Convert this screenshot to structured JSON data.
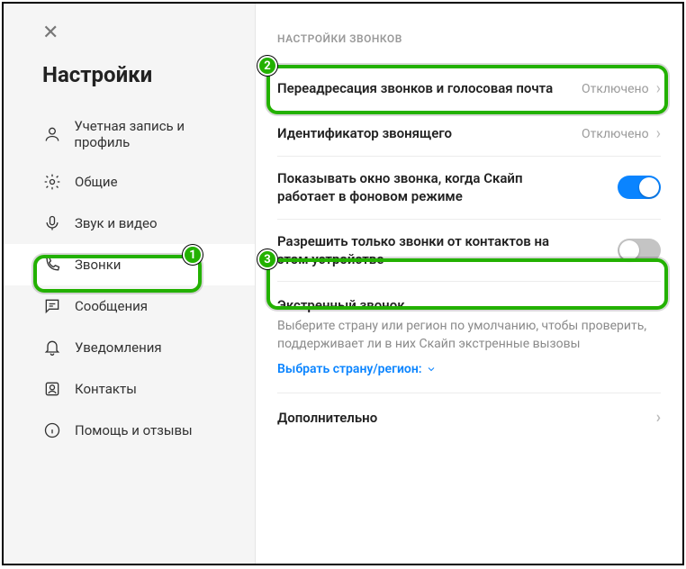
{
  "title": "Настройки",
  "sidebar": {
    "items": [
      {
        "label": "Учетная запись и профиль"
      },
      {
        "label": "Общие"
      },
      {
        "label": "Звук и видео"
      },
      {
        "label": "Звонки"
      },
      {
        "label": "Сообщения"
      },
      {
        "label": "Уведомления"
      },
      {
        "label": "Контакты"
      },
      {
        "label": "Помощь и отзывы"
      }
    ]
  },
  "content": {
    "header": "НАСТРОЙКИ ЗВОНКОВ",
    "forwarding": {
      "label": "Переадресация звонков и голосовая почта",
      "status": "Отключено"
    },
    "caller_id": {
      "label": "Идентификатор звонящего",
      "status": "Отключено"
    },
    "show_window": {
      "label": "Показывать окно звонка, когда Скайп работает в фоновом режиме",
      "on": true
    },
    "contacts_only": {
      "label": "Разрешить только звонки от контактов на этом устройстве",
      "on": false
    },
    "emergency": {
      "title": "Экстренный звонок",
      "desc": "Выберите страну или регион по умолчанию, чтобы проверить, поддерживает ли в них Скайп экстренные вызовы",
      "link": "Выбрать страну/регион:"
    },
    "advanced": "Дополнительно"
  },
  "annotations": {
    "b1": "1",
    "b2": "2",
    "b3": "3"
  }
}
